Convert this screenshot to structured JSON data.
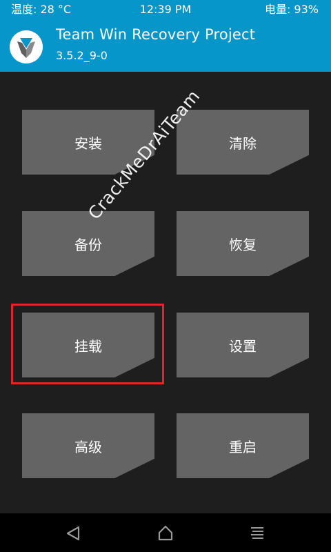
{
  "status": {
    "temperature": "温度: 28 °C",
    "time": "12:39 PM",
    "battery": "电量: 93%"
  },
  "header": {
    "title": "Team Win Recovery Project",
    "version": "3.5.2_9-0",
    "logo_icon": "twrp-logo-icon"
  },
  "buttons": {
    "install": "安装",
    "wipe": "清除",
    "backup": "备份",
    "restore": "恢复",
    "mount": "挂载",
    "settings": "设置",
    "advanced": "高级",
    "reboot": "重启"
  },
  "watermark": "CrackMeDrAiTeam",
  "navbar": {
    "back_icon": "back-triangle-icon",
    "home_icon": "home-icon",
    "menu_icon": "menu-lines-icon"
  },
  "colors": {
    "accent": "#0796c9",
    "button": "#646464",
    "background": "#1e1e1e",
    "highlight": "#e0242a"
  }
}
